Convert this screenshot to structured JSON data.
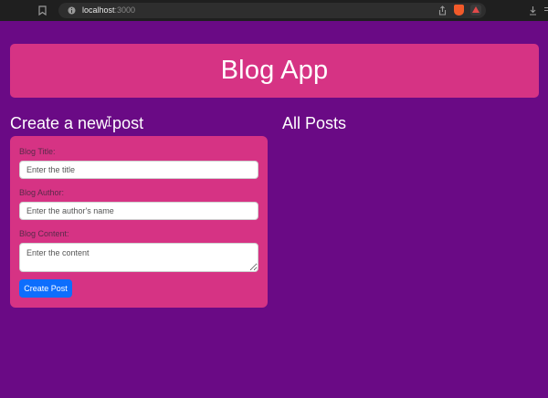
{
  "browser": {
    "url_host": "localhost",
    "url_port": ":3000"
  },
  "header": {
    "title": "Blog App"
  },
  "create_section": {
    "title": "Create a new post",
    "fields": [
      {
        "label": "Blog Title:",
        "placeholder": "Enter the title"
      },
      {
        "label": "Blog Author:",
        "placeholder": "Enter the author's name"
      },
      {
        "label": "Blog Content:",
        "placeholder": "Enter the content"
      }
    ],
    "submit_label": "Create Post"
  },
  "posts_section": {
    "title": "All Posts"
  },
  "colors": {
    "page_background": "#6a0a85",
    "card_pink": "#d63384",
    "button_blue": "#0d6efd"
  }
}
